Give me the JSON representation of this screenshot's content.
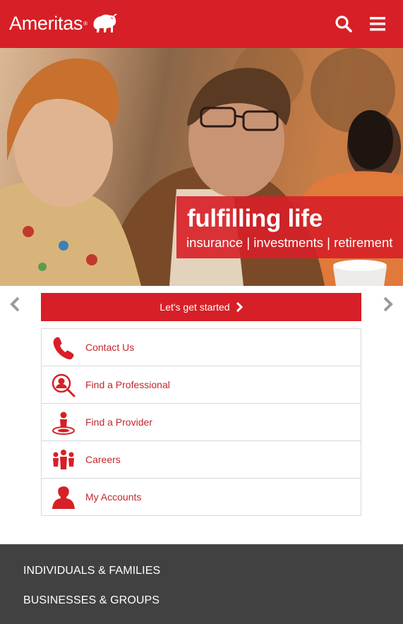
{
  "header": {
    "logo_text": "Ameritas",
    "logo_reg": "®",
    "brand_color": "#d71f27",
    "search_icon": "search-icon",
    "menu_icon": "hamburger-menu-icon"
  },
  "hero": {
    "headline": "fulfilling life",
    "tagline": "insurance | investments | retirement"
  },
  "carousel": {
    "prev_icon": "chevron-left-icon",
    "next_icon": "chevron-right-icon"
  },
  "cta": {
    "label": "Let's get started",
    "icon": "chevron-right-icon"
  },
  "quick_links": [
    {
      "label": "Contact Us",
      "icon": "phone-icon"
    },
    {
      "label": "Find a Professional",
      "icon": "person-search-icon"
    },
    {
      "label": "Find a Provider",
      "icon": "location-person-icon"
    },
    {
      "label": "Careers",
      "icon": "group-people-icon"
    },
    {
      "label": "My Accounts",
      "icon": "user-account-icon"
    }
  ],
  "footer": {
    "links": [
      {
        "label": "INDIVIDUALS & FAMILIES"
      },
      {
        "label": "BUSINESSES & GROUPS"
      }
    ]
  }
}
